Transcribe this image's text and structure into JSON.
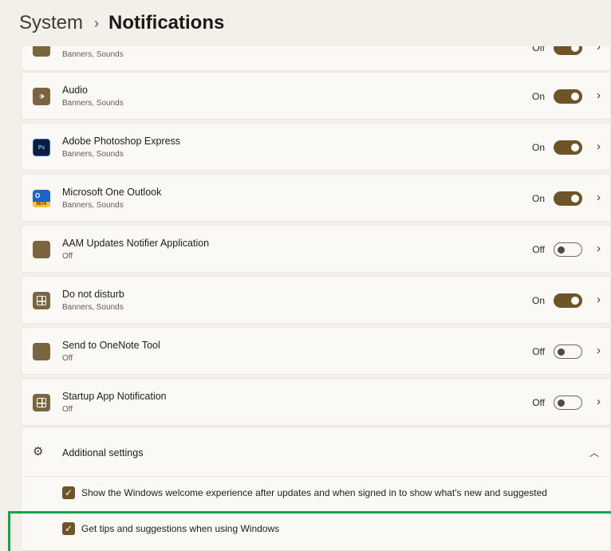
{
  "header": {
    "root": "System",
    "separator": "›",
    "current": "Notifications"
  },
  "apps": [
    {
      "name": "",
      "subtitle": "Banners, Sounds",
      "state": "Off",
      "icon": "app-icon",
      "toggle_on": true
    },
    {
      "name": "Audio",
      "subtitle": "Banners, Sounds",
      "state": "On",
      "icon": "audio-icon",
      "toggle_on": true
    },
    {
      "name": "Adobe Photoshop Express",
      "subtitle": "Banners, Sounds",
      "state": "On",
      "icon": "photoshop-express-icon",
      "toggle_on": true
    },
    {
      "name": "Microsoft One Outlook",
      "subtitle": "Banners, Sounds",
      "state": "On",
      "icon": "outlook-beta-icon",
      "toggle_on": true
    },
    {
      "name": "AAM Updates Notifier Application",
      "subtitle": "Off",
      "state": "Off",
      "icon": "app-icon",
      "toggle_on": false
    },
    {
      "name": "Do not disturb",
      "subtitle": "Banners, Sounds",
      "state": "On",
      "icon": "grid-app-icon",
      "toggle_on": true
    },
    {
      "name": "Send to OneNote Tool",
      "subtitle": "Off",
      "state": "Off",
      "icon": "app-icon",
      "toggle_on": false
    },
    {
      "name": "Startup App Notification",
      "subtitle": "Off",
      "state": "Off",
      "icon": "grid-app-icon",
      "toggle_on": false
    }
  ],
  "additional": {
    "title": "Additional settings",
    "options": [
      {
        "label": "Show the Windows welcome experience after updates and when signed in to show what's new and suggested",
        "checked": true
      },
      {
        "label": "Get tips and suggestions when using Windows",
        "checked": true
      }
    ]
  },
  "colors": {
    "accent": "#6e5528",
    "highlight": "#16a34a",
    "background": "#f3efe9",
    "card": "#fbf9f6"
  }
}
